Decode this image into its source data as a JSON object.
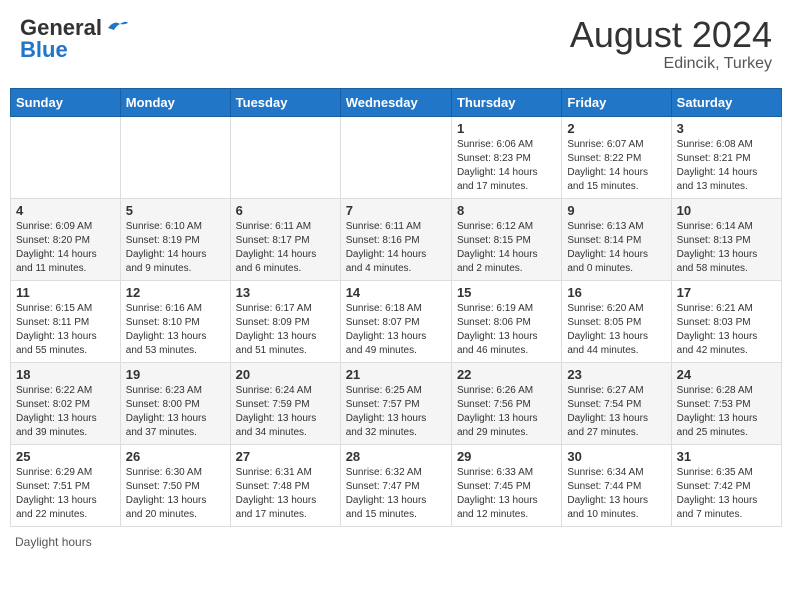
{
  "header": {
    "logo_general": "General",
    "logo_blue": "Blue",
    "month_title": "August 2024",
    "location": "Edincik, Turkey"
  },
  "footer": {
    "daylight_label": "Daylight hours"
  },
  "days_of_week": [
    "Sunday",
    "Monday",
    "Tuesday",
    "Wednesday",
    "Thursday",
    "Friday",
    "Saturday"
  ],
  "weeks": [
    [
      {
        "day": "",
        "info": ""
      },
      {
        "day": "",
        "info": ""
      },
      {
        "day": "",
        "info": ""
      },
      {
        "day": "",
        "info": ""
      },
      {
        "day": "1",
        "info": "Sunrise: 6:06 AM\nSunset: 8:23 PM\nDaylight: 14 hours\nand 17 minutes."
      },
      {
        "day": "2",
        "info": "Sunrise: 6:07 AM\nSunset: 8:22 PM\nDaylight: 14 hours\nand 15 minutes."
      },
      {
        "day": "3",
        "info": "Sunrise: 6:08 AM\nSunset: 8:21 PM\nDaylight: 14 hours\nand 13 minutes."
      }
    ],
    [
      {
        "day": "4",
        "info": "Sunrise: 6:09 AM\nSunset: 8:20 PM\nDaylight: 14 hours\nand 11 minutes."
      },
      {
        "day": "5",
        "info": "Sunrise: 6:10 AM\nSunset: 8:19 PM\nDaylight: 14 hours\nand 9 minutes."
      },
      {
        "day": "6",
        "info": "Sunrise: 6:11 AM\nSunset: 8:17 PM\nDaylight: 14 hours\nand 6 minutes."
      },
      {
        "day": "7",
        "info": "Sunrise: 6:11 AM\nSunset: 8:16 PM\nDaylight: 14 hours\nand 4 minutes."
      },
      {
        "day": "8",
        "info": "Sunrise: 6:12 AM\nSunset: 8:15 PM\nDaylight: 14 hours\nand 2 minutes."
      },
      {
        "day": "9",
        "info": "Sunrise: 6:13 AM\nSunset: 8:14 PM\nDaylight: 14 hours\nand 0 minutes."
      },
      {
        "day": "10",
        "info": "Sunrise: 6:14 AM\nSunset: 8:13 PM\nDaylight: 13 hours\nand 58 minutes."
      }
    ],
    [
      {
        "day": "11",
        "info": "Sunrise: 6:15 AM\nSunset: 8:11 PM\nDaylight: 13 hours\nand 55 minutes."
      },
      {
        "day": "12",
        "info": "Sunrise: 6:16 AM\nSunset: 8:10 PM\nDaylight: 13 hours\nand 53 minutes."
      },
      {
        "day": "13",
        "info": "Sunrise: 6:17 AM\nSunset: 8:09 PM\nDaylight: 13 hours\nand 51 minutes."
      },
      {
        "day": "14",
        "info": "Sunrise: 6:18 AM\nSunset: 8:07 PM\nDaylight: 13 hours\nand 49 minutes."
      },
      {
        "day": "15",
        "info": "Sunrise: 6:19 AM\nSunset: 8:06 PM\nDaylight: 13 hours\nand 46 minutes."
      },
      {
        "day": "16",
        "info": "Sunrise: 6:20 AM\nSunset: 8:05 PM\nDaylight: 13 hours\nand 44 minutes."
      },
      {
        "day": "17",
        "info": "Sunrise: 6:21 AM\nSunset: 8:03 PM\nDaylight: 13 hours\nand 42 minutes."
      }
    ],
    [
      {
        "day": "18",
        "info": "Sunrise: 6:22 AM\nSunset: 8:02 PM\nDaylight: 13 hours\nand 39 minutes."
      },
      {
        "day": "19",
        "info": "Sunrise: 6:23 AM\nSunset: 8:00 PM\nDaylight: 13 hours\nand 37 minutes."
      },
      {
        "day": "20",
        "info": "Sunrise: 6:24 AM\nSunset: 7:59 PM\nDaylight: 13 hours\nand 34 minutes."
      },
      {
        "day": "21",
        "info": "Sunrise: 6:25 AM\nSunset: 7:57 PM\nDaylight: 13 hours\nand 32 minutes."
      },
      {
        "day": "22",
        "info": "Sunrise: 6:26 AM\nSunset: 7:56 PM\nDaylight: 13 hours\nand 29 minutes."
      },
      {
        "day": "23",
        "info": "Sunrise: 6:27 AM\nSunset: 7:54 PM\nDaylight: 13 hours\nand 27 minutes."
      },
      {
        "day": "24",
        "info": "Sunrise: 6:28 AM\nSunset: 7:53 PM\nDaylight: 13 hours\nand 25 minutes."
      }
    ],
    [
      {
        "day": "25",
        "info": "Sunrise: 6:29 AM\nSunset: 7:51 PM\nDaylight: 13 hours\nand 22 minutes."
      },
      {
        "day": "26",
        "info": "Sunrise: 6:30 AM\nSunset: 7:50 PM\nDaylight: 13 hours\nand 20 minutes."
      },
      {
        "day": "27",
        "info": "Sunrise: 6:31 AM\nSunset: 7:48 PM\nDaylight: 13 hours\nand 17 minutes."
      },
      {
        "day": "28",
        "info": "Sunrise: 6:32 AM\nSunset: 7:47 PM\nDaylight: 13 hours\nand 15 minutes."
      },
      {
        "day": "29",
        "info": "Sunrise: 6:33 AM\nSunset: 7:45 PM\nDaylight: 13 hours\nand 12 minutes."
      },
      {
        "day": "30",
        "info": "Sunrise: 6:34 AM\nSunset: 7:44 PM\nDaylight: 13 hours\nand 10 minutes."
      },
      {
        "day": "31",
        "info": "Sunrise: 6:35 AM\nSunset: 7:42 PM\nDaylight: 13 hours\nand 7 minutes."
      }
    ]
  ]
}
